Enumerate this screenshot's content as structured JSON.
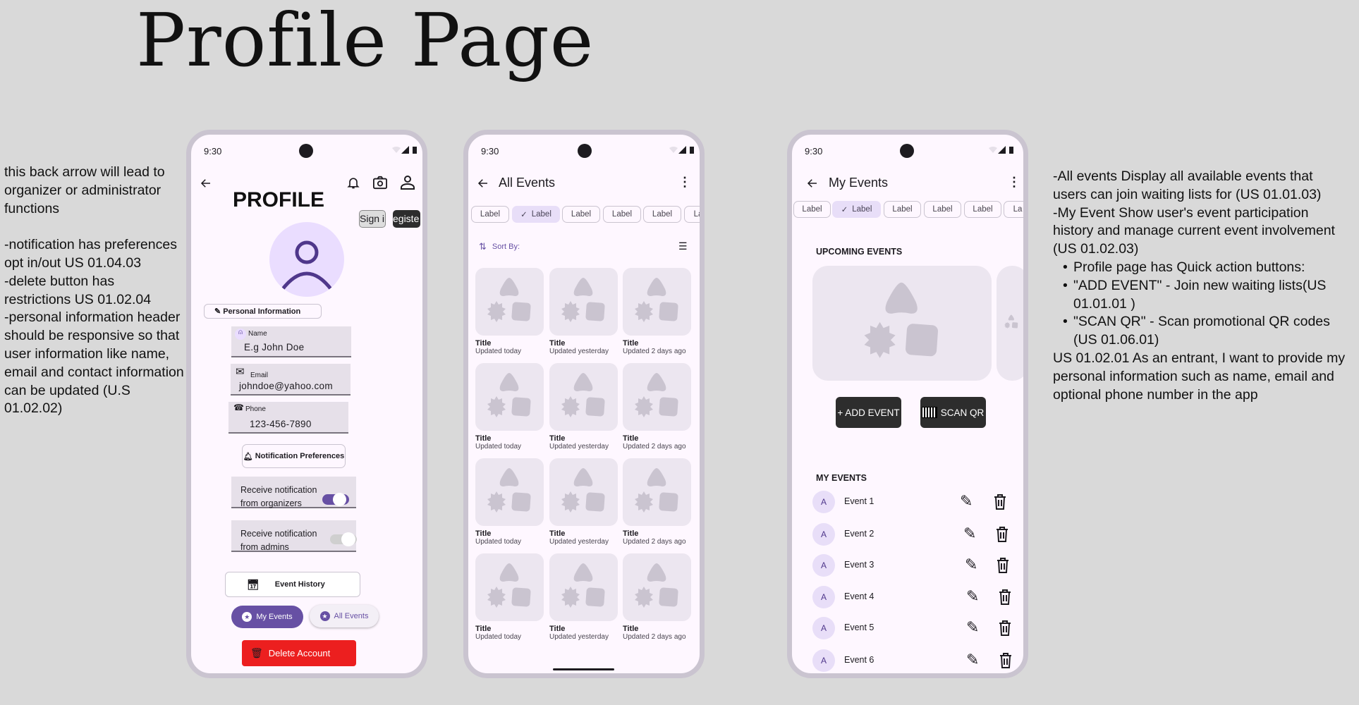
{
  "page_title": "Profile Page",
  "left_note": [
    "this back arrow will lead to organizer or administrator functions",
    "",
    "-notification has preferences opt in/out US 01.04.03",
    "-delete button has restrictions US 01.02.04",
    "-personal information header should be responsive so that user information like name, email and contact information can be updated (U.S 01.02.02)"
  ],
  "right_note": {
    "line1": "-All events Display all available events that users can join waiting lists for (US 01.01.03)",
    "line2": "-My Event Show user's event participation history and manage current event involvement (US 01.02.03)",
    "bullets": [
      "Profile page has Quick action buttons:",
      "\"ADD EVENT\" - Join new waiting lists(US 01.01.01 )",
      "\"SCAN QR\" - Scan promotional QR codes (US 01.06.01)"
    ],
    "line3": "US 01.02.01 As an entrant, I want to provide my personal information such as name, email and optional phone number in the app"
  },
  "status_time": "9:30",
  "profile": {
    "title": "PROFILE",
    "sign_in": "Sign in",
    "register": "egiste",
    "personal_info": "Personal Information",
    "name_label": "Name",
    "name_value": "E.g John Doe",
    "email_label": "Email",
    "email_value": "johndoe@yahoo.com",
    "phone_label": "Phone",
    "phone_value": "123-456-7890",
    "notif_prefs": "Notification Preferences",
    "toggle_organizers": {
      "label1": "Receive notification",
      "label2": "from organizers",
      "on": true
    },
    "toggle_admins": {
      "label1": "Receive notification",
      "label2": "from admins",
      "on": false
    },
    "event_history": "Event History",
    "my_events": "My Events",
    "all_events": "All Events",
    "delete_account": "Delete Account"
  },
  "all_events": {
    "title": "All Events",
    "chips": [
      "Label",
      "Label",
      "Label",
      "Label",
      "Label",
      "La"
    ],
    "selected_chip": 1,
    "sort_by": "Sort By:",
    "cards": [
      {
        "title": "Title",
        "sub": "Updated today"
      },
      {
        "title": "Title",
        "sub": "Updated yesterday"
      },
      {
        "title": "Title",
        "sub": "Updated 2 days ago"
      },
      {
        "title": "Title",
        "sub": "Updated today"
      },
      {
        "title": "Title",
        "sub": "Updated yesterday"
      },
      {
        "title": "Title",
        "sub": "Updated 2 days ago"
      },
      {
        "title": "Title",
        "sub": "Updated today"
      },
      {
        "title": "Title",
        "sub": "Updated yesterday"
      },
      {
        "title": "Title",
        "sub": "Updated 2 days ago"
      },
      {
        "title": "Title",
        "sub": "Updated today"
      },
      {
        "title": "Title",
        "sub": "Updated yesterday"
      },
      {
        "title": "Title",
        "sub": "Updated 2 days ago"
      }
    ]
  },
  "my_events": {
    "title": "My Events",
    "chips": [
      "Label",
      "Label",
      "Label",
      "Label",
      "Label",
      "La"
    ],
    "selected_chip": 1,
    "upcoming": "UPCOMING EVENTS",
    "add_event": "+ ADD EVENT",
    "scan_qr": "SCAN QR",
    "my_events_header": "MY EVENTS",
    "events": [
      {
        "avatar": "A",
        "name": "Event 1"
      },
      {
        "avatar": "A",
        "name": "Event 2"
      },
      {
        "avatar": "A",
        "name": "Event 3"
      },
      {
        "avatar": "A",
        "name": "Event 4"
      },
      {
        "avatar": "A",
        "name": "Event 5"
      },
      {
        "avatar": "A",
        "name": "Event 6"
      }
    ]
  },
  "colors": {
    "primary": "#6750a4",
    "danger": "#ec1f1f",
    "screen": "#fef7ff",
    "frame": "#cac4d0"
  }
}
